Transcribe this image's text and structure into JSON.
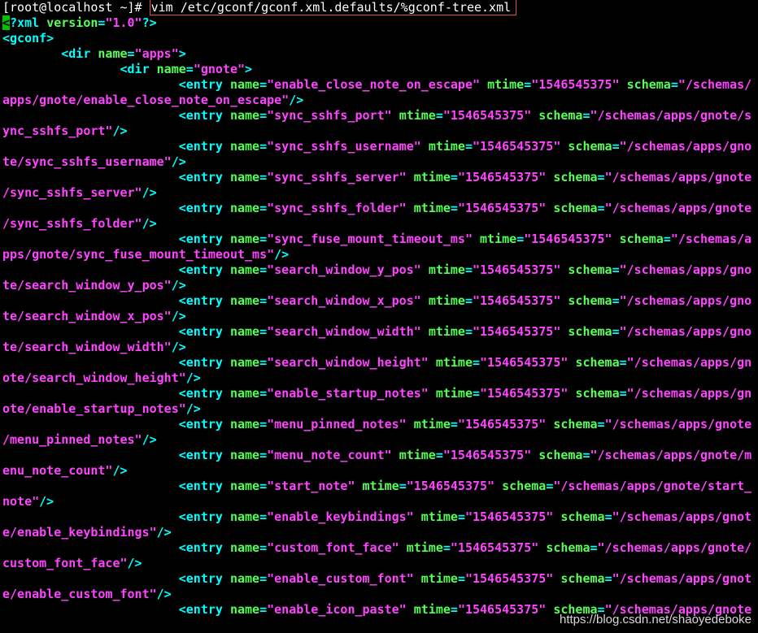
{
  "prompt": {
    "user_host": "[root@localhost ~]# ",
    "command": "vim /etc/gconf/gconf.xml.defaults/%gconf-tree.xml"
  },
  "editor": {
    "cursor_char": "<",
    "lines": [
      [
        [
          "tag",
          "?xml "
        ],
        [
          "attr",
          "version"
        ],
        [
          "tag",
          "="
        ],
        [
          "val",
          "\"1.0\""
        ],
        [
          "tag",
          "?>"
        ]
      ],
      [
        [
          "tag",
          "<gconf>"
        ]
      ],
      [
        [
          "ws",
          "        "
        ],
        [
          "tag",
          "<dir "
        ],
        [
          "attr",
          "name"
        ],
        [
          "tag",
          "="
        ],
        [
          "val",
          "\"apps\""
        ],
        [
          "tag",
          ">"
        ]
      ],
      [
        [
          "ws",
          "                "
        ],
        [
          "tag",
          "<dir "
        ],
        [
          "attr",
          "name"
        ],
        [
          "tag",
          "="
        ],
        [
          "val",
          "\"gnote\""
        ],
        [
          "tag",
          ">"
        ]
      ],
      [
        [
          "ws",
          "                        "
        ],
        [
          "tag",
          "<entry "
        ],
        [
          "attr",
          "name"
        ],
        [
          "tag",
          "="
        ],
        [
          "val",
          "\"enable_close_note_on_escape\""
        ],
        [
          "ws",
          " "
        ],
        [
          "attr",
          "mtime"
        ],
        [
          "tag",
          "="
        ],
        [
          "val",
          "\"1546545375\""
        ],
        [
          "ws",
          " "
        ],
        [
          "attr",
          "schema"
        ],
        [
          "tag",
          "="
        ],
        [
          "val",
          "\"/schemas/"
        ]
      ],
      [
        [
          "val",
          "apps/gnote/enable_close_note_on_escape\""
        ],
        [
          "tag",
          "/>"
        ]
      ],
      [
        [
          "ws",
          "                        "
        ],
        [
          "tag",
          "<entry "
        ],
        [
          "attr",
          "name"
        ],
        [
          "tag",
          "="
        ],
        [
          "val",
          "\"sync_sshfs_port\""
        ],
        [
          "ws",
          " "
        ],
        [
          "attr",
          "mtime"
        ],
        [
          "tag",
          "="
        ],
        [
          "val",
          "\"1546545375\""
        ],
        [
          "ws",
          " "
        ],
        [
          "attr",
          "schema"
        ],
        [
          "tag",
          "="
        ],
        [
          "val",
          "\"/schemas/apps/gnote/s"
        ]
      ],
      [
        [
          "val",
          "ync_sshfs_port\""
        ],
        [
          "tag",
          "/>"
        ]
      ],
      [
        [
          "ws",
          "                        "
        ],
        [
          "tag",
          "<entry "
        ],
        [
          "attr",
          "name"
        ],
        [
          "tag",
          "="
        ],
        [
          "val",
          "\"sync_sshfs_username\""
        ],
        [
          "ws",
          " "
        ],
        [
          "attr",
          "mtime"
        ],
        [
          "tag",
          "="
        ],
        [
          "val",
          "\"1546545375\""
        ],
        [
          "ws",
          " "
        ],
        [
          "attr",
          "schema"
        ],
        [
          "tag",
          "="
        ],
        [
          "val",
          "\"/schemas/apps/gno"
        ]
      ],
      [
        [
          "val",
          "te/sync_sshfs_username\""
        ],
        [
          "tag",
          "/>"
        ]
      ],
      [
        [
          "ws",
          "                        "
        ],
        [
          "tag",
          "<entry "
        ],
        [
          "attr",
          "name"
        ],
        [
          "tag",
          "="
        ],
        [
          "val",
          "\"sync_sshfs_server\""
        ],
        [
          "ws",
          " "
        ],
        [
          "attr",
          "mtime"
        ],
        [
          "tag",
          "="
        ],
        [
          "val",
          "\"1546545375\""
        ],
        [
          "ws",
          " "
        ],
        [
          "attr",
          "schema"
        ],
        [
          "tag",
          "="
        ],
        [
          "val",
          "\"/schemas/apps/gnote"
        ]
      ],
      [
        [
          "val",
          "/sync_sshfs_server\""
        ],
        [
          "tag",
          "/>"
        ]
      ],
      [
        [
          "ws",
          "                        "
        ],
        [
          "tag",
          "<entry "
        ],
        [
          "attr",
          "name"
        ],
        [
          "tag",
          "="
        ],
        [
          "val",
          "\"sync_sshfs_folder\""
        ],
        [
          "ws",
          " "
        ],
        [
          "attr",
          "mtime"
        ],
        [
          "tag",
          "="
        ],
        [
          "val",
          "\"1546545375\""
        ],
        [
          "ws",
          " "
        ],
        [
          "attr",
          "schema"
        ],
        [
          "tag",
          "="
        ],
        [
          "val",
          "\"/schemas/apps/gnote"
        ]
      ],
      [
        [
          "val",
          "/sync_sshfs_folder\""
        ],
        [
          "tag",
          "/>"
        ]
      ],
      [
        [
          "ws",
          "                        "
        ],
        [
          "tag",
          "<entry "
        ],
        [
          "attr",
          "name"
        ],
        [
          "tag",
          "="
        ],
        [
          "val",
          "\"sync_fuse_mount_timeout_ms\""
        ],
        [
          "ws",
          " "
        ],
        [
          "attr",
          "mtime"
        ],
        [
          "tag",
          "="
        ],
        [
          "val",
          "\"1546545375\""
        ],
        [
          "ws",
          " "
        ],
        [
          "attr",
          "schema"
        ],
        [
          "tag",
          "="
        ],
        [
          "val",
          "\"/schemas/a"
        ]
      ],
      [
        [
          "val",
          "pps/gnote/sync_fuse_mount_timeout_ms\""
        ],
        [
          "tag",
          "/>"
        ]
      ],
      [
        [
          "ws",
          "                        "
        ],
        [
          "tag",
          "<entry "
        ],
        [
          "attr",
          "name"
        ],
        [
          "tag",
          "="
        ],
        [
          "val",
          "\"search_window_y_pos\""
        ],
        [
          "ws",
          " "
        ],
        [
          "attr",
          "mtime"
        ],
        [
          "tag",
          "="
        ],
        [
          "val",
          "\"1546545375\""
        ],
        [
          "ws",
          " "
        ],
        [
          "attr",
          "schema"
        ],
        [
          "tag",
          "="
        ],
        [
          "val",
          "\"/schemas/apps/gno"
        ]
      ],
      [
        [
          "val",
          "te/search_window_y_pos\""
        ],
        [
          "tag",
          "/>"
        ]
      ],
      [
        [
          "ws",
          "                        "
        ],
        [
          "tag",
          "<entry "
        ],
        [
          "attr",
          "name"
        ],
        [
          "tag",
          "="
        ],
        [
          "val",
          "\"search_window_x_pos\""
        ],
        [
          "ws",
          " "
        ],
        [
          "attr",
          "mtime"
        ],
        [
          "tag",
          "="
        ],
        [
          "val",
          "\"1546545375\""
        ],
        [
          "ws",
          " "
        ],
        [
          "attr",
          "schema"
        ],
        [
          "tag",
          "="
        ],
        [
          "val",
          "\"/schemas/apps/gno"
        ]
      ],
      [
        [
          "val",
          "te/search_window_x_pos\""
        ],
        [
          "tag",
          "/>"
        ]
      ],
      [
        [
          "ws",
          "                        "
        ],
        [
          "tag",
          "<entry "
        ],
        [
          "attr",
          "name"
        ],
        [
          "tag",
          "="
        ],
        [
          "val",
          "\"search_window_width\""
        ],
        [
          "ws",
          " "
        ],
        [
          "attr",
          "mtime"
        ],
        [
          "tag",
          "="
        ],
        [
          "val",
          "\"1546545375\""
        ],
        [
          "ws",
          " "
        ],
        [
          "attr",
          "schema"
        ],
        [
          "tag",
          "="
        ],
        [
          "val",
          "\"/schemas/apps/gno"
        ]
      ],
      [
        [
          "val",
          "te/search_window_width\""
        ],
        [
          "tag",
          "/>"
        ]
      ],
      [
        [
          "ws",
          "                        "
        ],
        [
          "tag",
          "<entry "
        ],
        [
          "attr",
          "name"
        ],
        [
          "tag",
          "="
        ],
        [
          "val",
          "\"search_window_height\""
        ],
        [
          "ws",
          " "
        ],
        [
          "attr",
          "mtime"
        ],
        [
          "tag",
          "="
        ],
        [
          "val",
          "\"1546545375\""
        ],
        [
          "ws",
          " "
        ],
        [
          "attr",
          "schema"
        ],
        [
          "tag",
          "="
        ],
        [
          "val",
          "\"/schemas/apps/gn"
        ]
      ],
      [
        [
          "val",
          "ote/search_window_height\""
        ],
        [
          "tag",
          "/>"
        ]
      ],
      [
        [
          "ws",
          "                        "
        ],
        [
          "tag",
          "<entry "
        ],
        [
          "attr",
          "name"
        ],
        [
          "tag",
          "="
        ],
        [
          "val",
          "\"enable_startup_notes\""
        ],
        [
          "ws",
          " "
        ],
        [
          "attr",
          "mtime"
        ],
        [
          "tag",
          "="
        ],
        [
          "val",
          "\"1546545375\""
        ],
        [
          "ws",
          " "
        ],
        [
          "attr",
          "schema"
        ],
        [
          "tag",
          "="
        ],
        [
          "val",
          "\"/schemas/apps/gn"
        ]
      ],
      [
        [
          "val",
          "ote/enable_startup_notes\""
        ],
        [
          "tag",
          "/>"
        ]
      ],
      [
        [
          "ws",
          "                        "
        ],
        [
          "tag",
          "<entry "
        ],
        [
          "attr",
          "name"
        ],
        [
          "tag",
          "="
        ],
        [
          "val",
          "\"menu_pinned_notes\""
        ],
        [
          "ws",
          " "
        ],
        [
          "attr",
          "mtime"
        ],
        [
          "tag",
          "="
        ],
        [
          "val",
          "\"1546545375\""
        ],
        [
          "ws",
          " "
        ],
        [
          "attr",
          "schema"
        ],
        [
          "tag",
          "="
        ],
        [
          "val",
          "\"/schemas/apps/gnote"
        ]
      ],
      [
        [
          "val",
          "/menu_pinned_notes\""
        ],
        [
          "tag",
          "/>"
        ]
      ],
      [
        [
          "ws",
          "                        "
        ],
        [
          "tag",
          "<entry "
        ],
        [
          "attr",
          "name"
        ],
        [
          "tag",
          "="
        ],
        [
          "val",
          "\"menu_note_count\""
        ],
        [
          "ws",
          " "
        ],
        [
          "attr",
          "mtime"
        ],
        [
          "tag",
          "="
        ],
        [
          "val",
          "\"1546545375\""
        ],
        [
          "ws",
          " "
        ],
        [
          "attr",
          "schema"
        ],
        [
          "tag",
          "="
        ],
        [
          "val",
          "\"/schemas/apps/gnote/m"
        ]
      ],
      [
        [
          "val",
          "enu_note_count\""
        ],
        [
          "tag",
          "/>"
        ]
      ],
      [
        [
          "ws",
          "                        "
        ],
        [
          "tag",
          "<entry "
        ],
        [
          "attr",
          "name"
        ],
        [
          "tag",
          "="
        ],
        [
          "val",
          "\"start_note\""
        ],
        [
          "ws",
          " "
        ],
        [
          "attr",
          "mtime"
        ],
        [
          "tag",
          "="
        ],
        [
          "val",
          "\"1546545375\""
        ],
        [
          "ws",
          " "
        ],
        [
          "attr",
          "schema"
        ],
        [
          "tag",
          "="
        ],
        [
          "val",
          "\"/schemas/apps/gnote/start_"
        ]
      ],
      [
        [
          "val",
          "note\""
        ],
        [
          "tag",
          "/>"
        ]
      ],
      [
        [
          "ws",
          "                        "
        ],
        [
          "tag",
          "<entry "
        ],
        [
          "attr",
          "name"
        ],
        [
          "tag",
          "="
        ],
        [
          "val",
          "\"enable_keybindings\""
        ],
        [
          "ws",
          " "
        ],
        [
          "attr",
          "mtime"
        ],
        [
          "tag",
          "="
        ],
        [
          "val",
          "\"1546545375\""
        ],
        [
          "ws",
          " "
        ],
        [
          "attr",
          "schema"
        ],
        [
          "tag",
          "="
        ],
        [
          "val",
          "\"/schemas/apps/gnot"
        ]
      ],
      [
        [
          "val",
          "e/enable_keybindings\""
        ],
        [
          "tag",
          "/>"
        ]
      ],
      [
        [
          "ws",
          "                        "
        ],
        [
          "tag",
          "<entry "
        ],
        [
          "attr",
          "name"
        ],
        [
          "tag",
          "="
        ],
        [
          "val",
          "\"custom_font_face\""
        ],
        [
          "ws",
          " "
        ],
        [
          "attr",
          "mtime"
        ],
        [
          "tag",
          "="
        ],
        [
          "val",
          "\"1546545375\""
        ],
        [
          "ws",
          " "
        ],
        [
          "attr",
          "schema"
        ],
        [
          "tag",
          "="
        ],
        [
          "val",
          "\"/schemas/apps/gnote/"
        ]
      ],
      [
        [
          "val",
          "custom_font_face\""
        ],
        [
          "tag",
          "/>"
        ]
      ],
      [
        [
          "ws",
          "                        "
        ],
        [
          "tag",
          "<entry "
        ],
        [
          "attr",
          "name"
        ],
        [
          "tag",
          "="
        ],
        [
          "val",
          "\"enable_custom_font\""
        ],
        [
          "ws",
          " "
        ],
        [
          "attr",
          "mtime"
        ],
        [
          "tag",
          "="
        ],
        [
          "val",
          "\"1546545375\""
        ],
        [
          "ws",
          " "
        ],
        [
          "attr",
          "schema"
        ],
        [
          "tag",
          "="
        ],
        [
          "val",
          "\"/schemas/apps/gnot"
        ]
      ],
      [
        [
          "val",
          "e/enable_custom_font\""
        ],
        [
          "tag",
          "/>"
        ]
      ],
      [
        [
          "ws",
          "                        "
        ],
        [
          "tag",
          "<entry "
        ],
        [
          "attr",
          "name"
        ],
        [
          "tag",
          "="
        ],
        [
          "val",
          "\"enable_icon_paste\""
        ],
        [
          "ws",
          " "
        ],
        [
          "attr",
          "mtime"
        ],
        [
          "tag",
          "="
        ],
        [
          "val",
          "\"1546545375\""
        ],
        [
          "ws",
          " "
        ],
        [
          "attr",
          "schema"
        ],
        [
          "tag",
          "="
        ],
        [
          "val",
          "\"/schemas/apps/gnote"
        ]
      ]
    ]
  },
  "watermark": "https://blog.csdn.net/shaoyedeboke",
  "colors": {
    "background": "#000000",
    "tag": "#00ffff",
    "attribute": "#55ff55",
    "value": "#ff44ff",
    "cursor": "#00c000",
    "command_highlight": "#e05050"
  }
}
